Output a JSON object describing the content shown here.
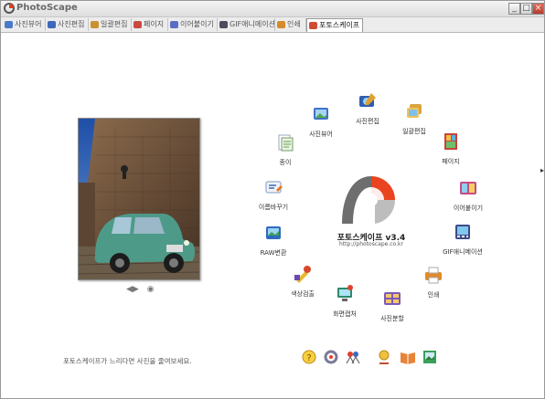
{
  "window": {
    "title": "PhotoScape",
    "minimize": "_",
    "maximize": "□",
    "close": "×"
  },
  "tabs": [
    {
      "label": "사진뷰어",
      "color": "#4a79c8"
    },
    {
      "label": "사진편집",
      "color": "#3e68b9"
    },
    {
      "label": "일괄편집",
      "color": "#c99230"
    },
    {
      "label": "페이지",
      "color": "#c84a42"
    },
    {
      "label": "이어붙이기",
      "color": "#5a6ec6"
    },
    {
      "label": "GIF애니메이션",
      "color": "#4b4b5c"
    },
    {
      "label": "인쇄",
      "color": "#d68a2a"
    },
    {
      "label": "포토스케이프",
      "color": "#d04a36"
    }
  ],
  "active_tab": 7,
  "brand": {
    "name": "포토스케이프 v3.4",
    "url": "http://photoscape.co.kr"
  },
  "menu": [
    {
      "label": "사진뷰어",
      "icon": "photo-viewer-icon"
    },
    {
      "label": "사진편집",
      "icon": "photo-editor-icon"
    },
    {
      "label": "일괄편집",
      "icon": "batch-editor-icon"
    },
    {
      "label": "페이지",
      "icon": "page-icon"
    },
    {
      "label": "이어붙이기",
      "icon": "combine-icon"
    },
    {
      "label": "GIF애니메이션",
      "icon": "gif-animation-icon"
    },
    {
      "label": "인쇄",
      "icon": "print-icon"
    },
    {
      "label": "사진분할",
      "icon": "splitter-icon"
    },
    {
      "label": "화면캡처",
      "icon": "screen-capture-icon"
    },
    {
      "label": "색상검출",
      "icon": "color-picker-icon"
    },
    {
      "label": "RAW변환",
      "icon": "raw-converter-icon"
    },
    {
      "label": "이름바꾸기",
      "icon": "rename-icon"
    },
    {
      "label": "종이",
      "icon": "paper-print-icon"
    }
  ],
  "hint": "포토스케이프가 느리다면 사진을 줄여보세요.",
  "photo_nav": {
    "prev": "◀▶",
    "next": "◉"
  }
}
